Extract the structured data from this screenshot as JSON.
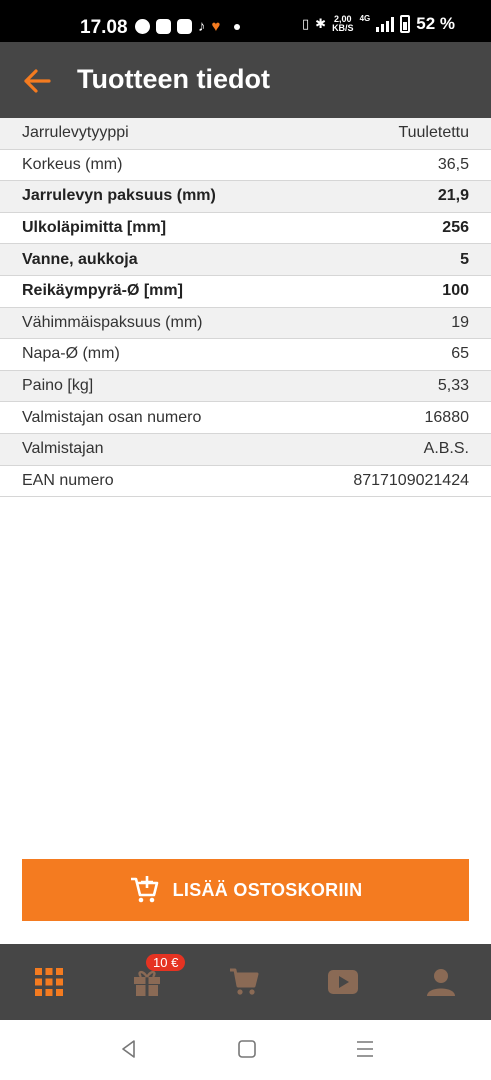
{
  "status_bar": {
    "time": "17.08",
    "net_speed_top": "2,00",
    "net_speed_bottom": "KB/S",
    "network_type": "4G",
    "battery": "52 %"
  },
  "header": {
    "title": "Tuotteen tiedot",
    "back_icon": "arrow-left-icon"
  },
  "specs": [
    {
      "label": "Jarrulevytyyppi",
      "value": "Tuuletettu",
      "bold": false
    },
    {
      "label": "Korkeus (mm)",
      "value": "36,5",
      "bold": false
    },
    {
      "label": "Jarrulevyn paksuus (mm)",
      "value": "21,9",
      "bold": true
    },
    {
      "label": "Ulkoläpimitta [mm]",
      "value": "256",
      "bold": true
    },
    {
      "label": "Vanne, aukkoja",
      "value": "5",
      "bold": true
    },
    {
      "label": "Reikäympyrä-Ø [mm]",
      "value": "100",
      "bold": true
    },
    {
      "label": "Vähimmäispaksuus (mm)",
      "value": "19",
      "bold": false
    },
    {
      "label": "Napa-Ø (mm)",
      "value": "65",
      "bold": false
    },
    {
      "label": "Paino [kg]",
      "value": "5,33",
      "bold": false
    },
    {
      "label": "Valmistajan osan numero",
      "value": "16880",
      "bold": false
    },
    {
      "label": "Valmistajan",
      "value": "A.B.S.",
      "bold": false
    },
    {
      "label": "EAN numero",
      "value": "8717109021424",
      "bold": false
    }
  ],
  "cart_button": {
    "label": "LISÄÄ OSTOSKORIIN",
    "icon": "add-to-cart-icon"
  },
  "bottom_nav": {
    "items": [
      "grid-menu-icon",
      "gift-icon",
      "cart-icon",
      "video-icon",
      "person-icon"
    ],
    "gift_badge": "10 €"
  },
  "colors": {
    "accent": "#f47b20",
    "bar": "#464646",
    "nav_icon": "#8a6a55",
    "badge": "#e53322"
  }
}
